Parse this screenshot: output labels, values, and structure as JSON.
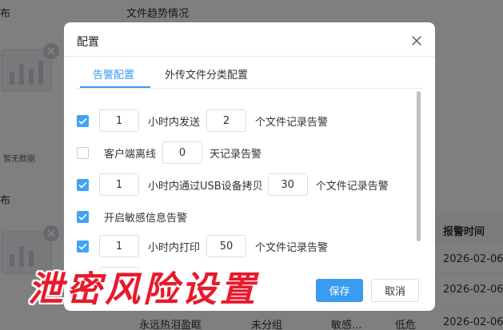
{
  "background": {
    "top_left_fragment": "布",
    "chart_title": "文件趋势情况",
    "no_data_label": "暂无数据",
    "middle_left_fragment": "布",
    "table": {
      "header_alarm_time": "报警时间",
      "time_values": [
        "2026-02-06",
        "2026-02-06",
        "2026-02-06"
      ],
      "bottom_row": {
        "name": "永远热泪盈眶",
        "group": "未分组",
        "type": "敏感...",
        "level": "低危",
        "time": "2026-02-06"
      }
    }
  },
  "dialog": {
    "title": "配置",
    "tabs": [
      {
        "label": "告警配置",
        "active": true
      },
      {
        "label": "外传文件分类配置",
        "active": false
      }
    ],
    "rules": [
      {
        "checked": true,
        "parts": [
          {
            "value": "1"
          },
          {
            "text": "小时内发送"
          },
          {
            "value": "2"
          },
          {
            "text": "个文件记录告警"
          }
        ]
      },
      {
        "checked": false,
        "parts": [
          {
            "text": "客户端离线"
          },
          {
            "value": "0"
          },
          {
            "text": "天记录告警"
          }
        ]
      },
      {
        "checked": true,
        "parts": [
          {
            "value": "1"
          },
          {
            "text": "小时内通过USB设备拷贝"
          },
          {
            "value": "30"
          },
          {
            "text": "个文件记录告警"
          }
        ]
      },
      {
        "checked": true,
        "parts": [
          {
            "text": "开启敏感信息告警"
          }
        ]
      },
      {
        "checked": true,
        "parts": [
          {
            "value": "1"
          },
          {
            "text": "小时内打印"
          },
          {
            "value": "50"
          },
          {
            "text": "个文件记录告警"
          }
        ]
      }
    ],
    "buttons": {
      "save": "保存",
      "cancel": "取消"
    }
  },
  "caption": "泄密风险设置",
  "colors": {
    "accent": "#3a9bf0",
    "checkbox_checked": "#40a3f5",
    "caption_red": "#e8192c",
    "overlay": "rgba(0,0,0,0.5)"
  }
}
